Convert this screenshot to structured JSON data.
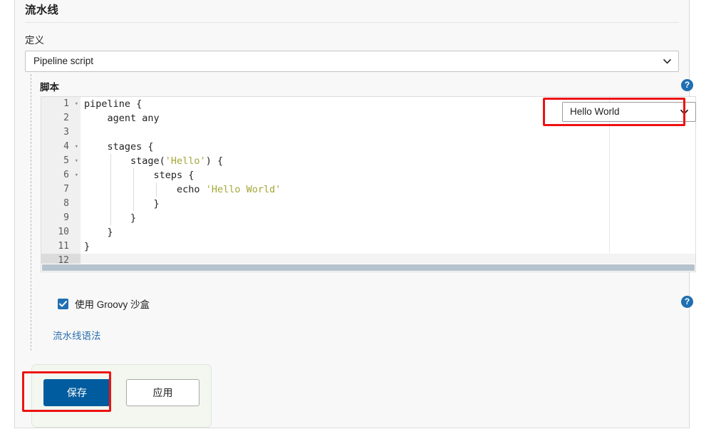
{
  "section": {
    "title": "流水线",
    "definition_label": "定义"
  },
  "definition_select": {
    "value": "Pipeline script",
    "icon": "chevron-down-icon"
  },
  "script": {
    "label": "脚本",
    "help_icon": "help-circle-icon",
    "help_glyph": "?"
  },
  "sample_select": {
    "value": "Hello World",
    "icon": "chevron-down-icon"
  },
  "editor": {
    "lines": [
      {
        "num": "1",
        "fold": "▾",
        "text": "pipeline {",
        "guides": []
      },
      {
        "num": "2",
        "fold": "",
        "text": "    agent any",
        "guides": []
      },
      {
        "num": "3",
        "fold": "",
        "text": "",
        "guides": []
      },
      {
        "num": "4",
        "fold": "▾",
        "text": "    stages {",
        "guides": []
      },
      {
        "num": "5",
        "fold": "▾",
        "text": "        stage('Hello') {",
        "guides": [
          42
        ]
      },
      {
        "num": "6",
        "fold": "▾",
        "text": "            steps {",
        "guides": [
          42,
          74
        ]
      },
      {
        "num": "7",
        "fold": "",
        "text": "                echo 'Hello World'",
        "guides": [
          42,
          74,
          106
        ]
      },
      {
        "num": "8",
        "fold": "",
        "text": "            }",
        "guides": [
          42,
          74
        ]
      },
      {
        "num": "9",
        "fold": "",
        "text": "        }",
        "guides": [
          42
        ]
      },
      {
        "num": "10",
        "fold": "",
        "text": "    }",
        "guides": []
      },
      {
        "num": "11",
        "fold": "",
        "text": "}",
        "guides": []
      },
      {
        "num": "12",
        "fold": "",
        "text": "",
        "guides": []
      }
    ],
    "string_tokens": [
      "'Hello'",
      "'Hello World'"
    ],
    "active_line": "12",
    "string_color": "#a2a737"
  },
  "sandbox": {
    "label": "使用 Groovy 沙盒",
    "checked": true,
    "help_icon": "help-circle-icon",
    "help_glyph": "?"
  },
  "syntax_link": {
    "label": "流水线语法"
  },
  "buttons": {
    "save": "保存",
    "apply": "应用"
  },
  "highlights": {
    "color": "#ee1111",
    "targets": [
      "sample-select",
      "save-button"
    ]
  }
}
